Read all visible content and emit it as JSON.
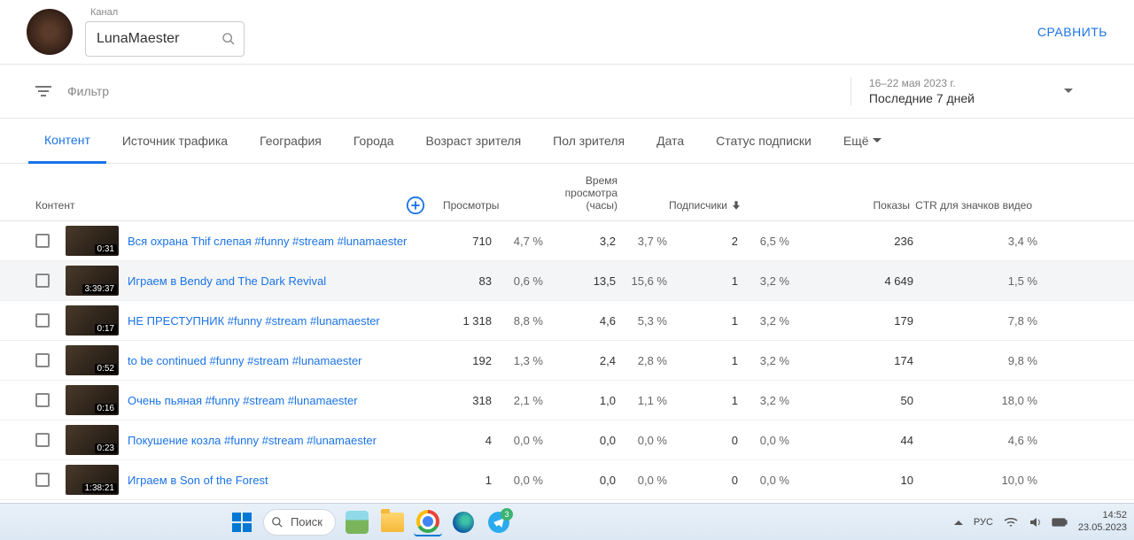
{
  "header": {
    "channel_label": "Канал",
    "channel_name": "LunaMaester",
    "compare": "СРАВНИТЬ"
  },
  "filter": {
    "placeholder": "Фильтр",
    "date_range": "16–22 мая 2023 г.",
    "date_preset": "Последние 7 дней"
  },
  "tabs": {
    "items": [
      {
        "label": "Контент",
        "active": true
      },
      {
        "label": "Источник трафика"
      },
      {
        "label": "География"
      },
      {
        "label": "Города"
      },
      {
        "label": "Возраст зрителя"
      },
      {
        "label": "Пол зрителя"
      },
      {
        "label": "Дата"
      },
      {
        "label": "Статус подписки"
      }
    ],
    "more": "Ещё"
  },
  "columns": {
    "content": "Контент",
    "views": "Просмотры",
    "watch": "Время просмотра (часы)",
    "subs": "Подписчики",
    "impr": "Показы",
    "ctr": "CTR для значков видео"
  },
  "rows": [
    {
      "dur": "0:31",
      "title": "Вся охрана Thif слепая #funny #stream #lunamaester",
      "views": "710",
      "views_pct": "4,7 %",
      "watch": "3,2",
      "watch_pct": "3,7 %",
      "subs": "2",
      "subs_pct": "6,5 %",
      "impr": "236",
      "ctr": "3,4 %"
    },
    {
      "dur": "3:39:37",
      "title": "Играем в Bendy and The Dark Revival",
      "views": "83",
      "views_pct": "0,6 %",
      "watch": "13,5",
      "watch_pct": "15,6 %",
      "subs": "1",
      "subs_pct": "3,2 %",
      "impr": "4 649",
      "ctr": "1,5 %",
      "highlight": true
    },
    {
      "dur": "0:17",
      "title": "НЕ ПРЕСТУПНИК #funny #stream #lunamaester",
      "views": "1 318",
      "views_pct": "8,8 %",
      "watch": "4,6",
      "watch_pct": "5,3 %",
      "subs": "1",
      "subs_pct": "3,2 %",
      "impr": "179",
      "ctr": "7,8 %"
    },
    {
      "dur": "0:52",
      "title": "to be continued #funny #stream #lunamaester",
      "views": "192",
      "views_pct": "1,3 %",
      "watch": "2,4",
      "watch_pct": "2,8 %",
      "subs": "1",
      "subs_pct": "3,2 %",
      "impr": "174",
      "ctr": "9,8 %"
    },
    {
      "dur": "0:16",
      "title": "Очень пьяная #funny #stream #lunamaester",
      "views": "318",
      "views_pct": "2,1 %",
      "watch": "1,0",
      "watch_pct": "1,1 %",
      "subs": "1",
      "subs_pct": "3,2 %",
      "impr": "50",
      "ctr": "18,0 %"
    },
    {
      "dur": "0:23",
      "title": "Покушение козла #funny #stream #lunamaester",
      "views": "4",
      "views_pct": "0,0 %",
      "watch": "0,0",
      "watch_pct": "0,0 %",
      "subs": "0",
      "subs_pct": "0,0 %",
      "impr": "44",
      "ctr": "4,6 %"
    },
    {
      "dur": "1:38:21",
      "title": "Играем в Son of the Forest",
      "views": "1",
      "views_pct": "0,0 %",
      "watch": "0,0",
      "watch_pct": "0,0 %",
      "subs": "0",
      "subs_pct": "0,0 %",
      "impr": "10",
      "ctr": "10,0 %"
    }
  ],
  "taskbar": {
    "search": "Поиск",
    "lang": "РУС",
    "tg_badge": "3",
    "time": "14:52",
    "date": "23.05.2023"
  }
}
